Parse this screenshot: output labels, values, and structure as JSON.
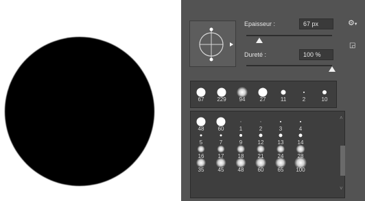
{
  "panel": {
    "thickness_label": "Epaisseur :",
    "thickness_value": "67 px",
    "thickness_level": 0.15,
    "hardness_label": "Dureté :",
    "hardness_value": "100 %",
    "hardness_level": 1.0,
    "gear_icon": "⚙",
    "gear_caret": "▾",
    "new_preset_icon": "◲"
  },
  "recent_brushes": [
    {
      "label": "67",
      "type": "hard",
      "d": 13
    },
    {
      "label": "229",
      "type": "hard",
      "d": 13
    },
    {
      "label": "94",
      "type": "soft",
      "d": 16
    },
    {
      "label": "27",
      "type": "hard",
      "d": 13
    },
    {
      "label": "11",
      "type": "hard",
      "d": 7
    },
    {
      "label": "2",
      "type": "hard",
      "d": 2
    },
    {
      "label": "10",
      "type": "hard",
      "d": 6
    }
  ],
  "preset_brushes": [
    {
      "label": "48",
      "type": "hard",
      "d": 13
    },
    {
      "label": "60",
      "type": "hard",
      "d": 13
    },
    {
      "label": "1",
      "type": "hard",
      "d": 1
    },
    {
      "label": "2",
      "type": "hard",
      "d": 1
    },
    {
      "label": "3",
      "type": "hard",
      "d": 2
    },
    {
      "label": "4",
      "type": "hard",
      "d": 2
    },
    {
      "label": "5",
      "type": "hard",
      "d": 3
    },
    {
      "label": "7",
      "type": "hard",
      "d": 3
    },
    {
      "label": "9",
      "type": "hard",
      "d": 4
    },
    {
      "label": "12",
      "type": "hard",
      "d": 5
    },
    {
      "label": "13",
      "type": "hard",
      "d": 5
    },
    {
      "label": "14",
      "type": "hard",
      "d": 5
    },
    {
      "label": "16",
      "type": "soft",
      "d": 11
    },
    {
      "label": "17",
      "type": "soft",
      "d": 11
    },
    {
      "label": "18",
      "type": "soft",
      "d": 12
    },
    {
      "label": "21",
      "type": "soft",
      "d": 12
    },
    {
      "label": "24",
      "type": "soft",
      "d": 12
    },
    {
      "label": "28",
      "type": "soft",
      "d": 13
    },
    {
      "label": "35",
      "type": "soft",
      "d": 14
    },
    {
      "label": "45",
      "type": "soft",
      "d": 15
    },
    {
      "label": "48",
      "type": "soft",
      "d": 15
    },
    {
      "label": "60",
      "type": "soft",
      "d": 16
    },
    {
      "label": "65",
      "type": "soft",
      "d": 16
    },
    {
      "label": "100",
      "type": "soft",
      "d": 18
    }
  ],
  "scroll": {
    "up": "˄",
    "down": "˅"
  }
}
